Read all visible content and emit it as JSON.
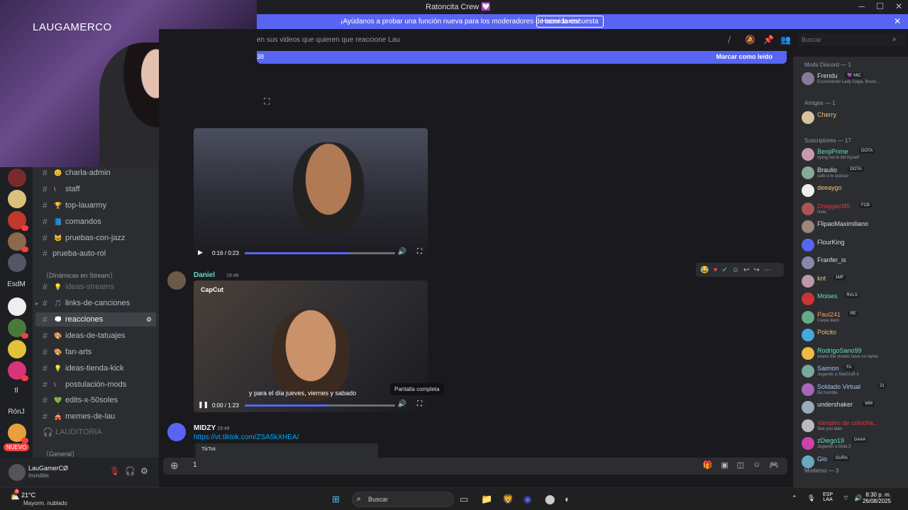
{
  "window": {
    "title": "Ratoncita Crew 💟"
  },
  "banner": {
    "text": "¡Ayúdanos a probar una función nueva para los moderadores de servidores!",
    "button": "Hacer la encuesta",
    "close": "✕"
  },
  "webcam": {
    "label": "LAUGAMERCO"
  },
  "servers": {
    "rail_labels": [
      "EsdM",
      "tl",
      "RónJ"
    ],
    "new_label": "NUEVO"
  },
  "channels": {
    "items": [
      {
        "name": "charla-admin",
        "emoji": "😊"
      },
      {
        "name": "staff",
        "emoji": "\\"
      },
      {
        "name": "top-lauarmy",
        "emoji": "🏆"
      },
      {
        "name": "comandos",
        "emoji": "📘"
      },
      {
        "name": "pruebas-con-jazz",
        "emoji": "😺"
      },
      {
        "name": "prueba-auto-rol",
        "emoji": ""
      }
    ],
    "category_dinamicas": "〔Dinámicas en Stream〕",
    "items2": [
      {
        "name": "ideas-streams",
        "emoji": "💡"
      },
      {
        "name": "links-de-canciones",
        "emoji": "🎵"
      },
      {
        "name": "reacciones",
        "emoji": "💭"
      },
      {
        "name": "ideas-de-tatuajes",
        "emoji": "🎨"
      },
      {
        "name": "fan-arts",
        "emoji": "🎨"
      },
      {
        "name": "ideas-tienda-kick",
        "emoji": "💡"
      },
      {
        "name": "postulación-mods",
        "emoji": "\\"
      },
      {
        "name": "edits-x-50soles",
        "emoji": "💚"
      },
      {
        "name": "memes-de-lau",
        "emoji": "🎪"
      }
    ],
    "voice": "LAUDITORIA",
    "category_general": "〔General〕"
  },
  "user": {
    "name": "LauGamerCØ",
    "status": "Invisible"
  },
  "chat": {
    "topic": "en sus videos que quieren que reaccione Lau",
    "new_count": "38",
    "mark_read": "Marcar como leído",
    "video1": {
      "time": "0:16 / 0:23",
      "progress": 0.7
    },
    "msg2": {
      "author": "Daniel",
      "time": "19:49"
    },
    "video2": {
      "overlay_brand": "CapCut",
      "subtitle": "y para el día jueves, viernes y sabado",
      "time": "0:00 / 1:23",
      "progress": 0.55
    },
    "tooltip": "Pantalla completa",
    "msg3": {
      "author": "MIDZY",
      "time": "19:49",
      "link": "https://vt.tiktok.com/ZSA5kXHEA/",
      "embed": "TikTok"
    }
  },
  "composer": {
    "value": "1"
  },
  "search": {
    "placeholder": "Buscar"
  },
  "members": {
    "cat_mods": "Mods Discord — 1",
    "cat_amigos": "Amigos — 1",
    "cat_subs": "Suscriptores — 17",
    "cat_moderno": "Moderno — 3",
    "list": [
      {
        "name": "Frendu",
        "tag": "💜 MIC",
        "status": "Escuchando Lady Gaga, Bruno ...",
        "color": "#dbdee1"
      },
      {
        "name": "Cherry",
        "tag": "",
        "status": "",
        "color": "#f0c674"
      },
      {
        "name": "BenjiPrime",
        "tag": "DOTA",
        "status": "trying not to kill myself",
        "color": "#5ee0c4"
      },
      {
        "name": "Braulio",
        "tag": "DOTA",
        "status": "safe o te avanzo",
        "color": "#dbdee1"
      },
      {
        "name": "deeaygo",
        "tag": "",
        "status": "",
        "color": "#f0c674"
      },
      {
        "name": "Draggacf45",
        "tag": "FCB",
        "status": "Hola",
        "color": "#e23636"
      },
      {
        "name": "FlipaoMaximiliano",
        "tag": "",
        "status": "",
        "color": "#dbdee1"
      },
      {
        "name": "FlourKing",
        "tag": "",
        "status": "",
        "color": "#dbdee1"
      },
      {
        "name": "Franfer_is",
        "tag": "",
        "status": "",
        "color": "#dbdee1"
      },
      {
        "name": "knt",
        "tag": "1MF",
        "status": "",
        "color": "#f0c674"
      },
      {
        "name": "Moises",
        "tag": "RVLS",
        "status": "",
        "color": "#5ee0c4"
      },
      {
        "name": "Paul241",
        "tag": "RE",
        "status": "Carpe diem",
        "color": "#f0a060"
      },
      {
        "name": "Polcito",
        "tag": "",
        "status": "",
        "color": "#f0c674"
      },
      {
        "name": "RodrigoSano99",
        "tag": "",
        "status": "where the streets have no name",
        "color": "#5ee0c4"
      },
      {
        "name": "Saimon",
        "tag": "FA",
        "status": "Jugando a StarCraft II",
        "color": "#a4c2f4"
      },
      {
        "name": "Soldado Virtual",
        "tag": "21",
        "status": "Be humble.",
        "color": "#a4c2f4"
      },
      {
        "name": "undershaker",
        "tag": "WM",
        "status": "",
        "color": "#dbdee1"
      },
      {
        "name": "Vampiro de colocha...",
        "tag": "",
        "status": "See you later",
        "color": "#e23636"
      },
      {
        "name": "zDiego19",
        "tag": "GAAA",
        "status": "Jugando a Dota 2",
        "color": "#5ee0c4"
      },
      {
        "name": "Gio",
        "tag": "GURA",
        "status": "",
        "color": "#a4c2f4"
      }
    ]
  },
  "taskbar": {
    "weather_temp": "21°C",
    "weather_desc": "Mayorm. nublado",
    "weather_badge": "3",
    "search": "Buscar",
    "lang1": "ESP",
    "lang2": "LAA",
    "time": "8:30 p. m.",
    "date": "26/08/2025"
  },
  "colors": {
    "accent": "#5865f2",
    "danger": "#f23f43",
    "bg": "#1a1a1e",
    "sidebar": "#2b2d31"
  }
}
